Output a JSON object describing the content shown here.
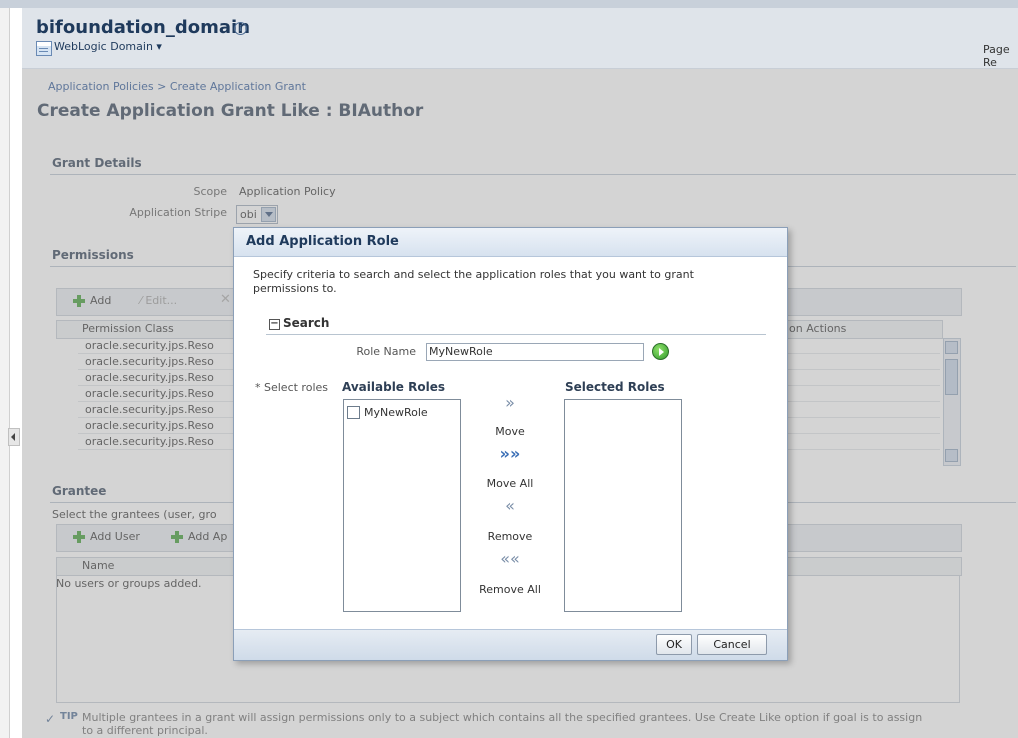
{
  "header": {
    "title": "bifoundation_domain",
    "domain_menu": "WebLogic Domain",
    "page_ref": "Page Re"
  },
  "breadcrumb": "Application Policies > Create Application Grant",
  "page_title": "Create Application Grant Like : BIAuthor",
  "grant_details": {
    "heading": "Grant Details",
    "scope_label": "Scope",
    "scope_value": "Application Policy",
    "stripe_label": "Application Stripe",
    "stripe_value": "obi"
  },
  "permissions": {
    "heading": "Permissions",
    "toolbar": {
      "add": "Add",
      "edit": "Edit..."
    },
    "columns": [
      "Permission Class",
      "on Actions"
    ],
    "rows": [
      "oracle.security.jps.Reso",
      "oracle.security.jps.Reso",
      "oracle.security.jps.Reso",
      "oracle.security.jps.Reso",
      "oracle.security.jps.Reso",
      "oracle.security.jps.Reso",
      "oracle.security.jps.Reso"
    ]
  },
  "grantee": {
    "heading": "Grantee",
    "description": "Select the grantees (user, gro",
    "toolbar": {
      "add_user": "Add User",
      "add_ap": "Add Ap"
    },
    "columns": [
      "Name"
    ],
    "empty_text": "No users or groups added."
  },
  "tip": {
    "label": "TIP",
    "text": "Multiple grantees in a grant will assign permissions only to a subject which contains all the specified grantees. Use Create Like option if goal is to assign",
    "text2": "to a different principal."
  },
  "dialog": {
    "title": "Add Application Role",
    "instructions": "Specify criteria to search and select the application roles that you want to grant permissions to.",
    "search_heading": "Search",
    "role_name_label": "Role Name",
    "role_name_value": "MyNewRole",
    "select_roles_label": "* Select roles",
    "available_heading": "Available Roles",
    "selected_heading": "Selected Roles",
    "available_items": [
      "MyNewRole"
    ],
    "selected_items": [],
    "shuttle": {
      "move": "Move",
      "move_all": "Move All",
      "remove": "Remove",
      "remove_all": "Remove All"
    },
    "ok": "OK",
    "cancel": "Cancel"
  }
}
